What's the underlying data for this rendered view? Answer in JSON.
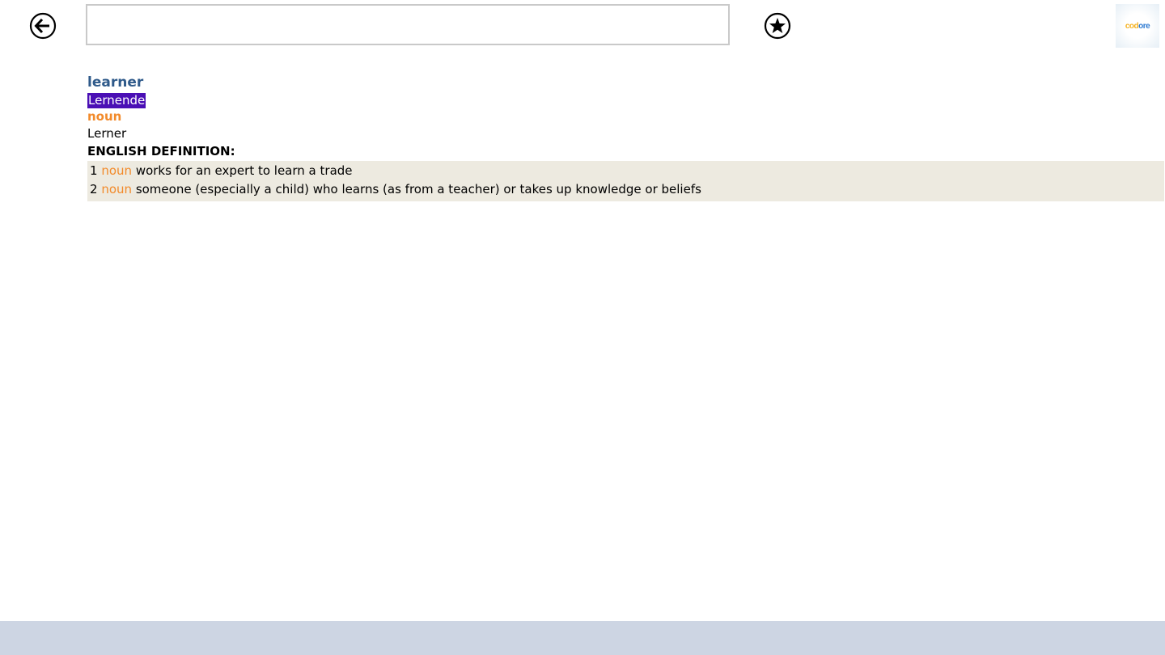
{
  "toolbar": {
    "back_icon": "arrow-left-circle-icon",
    "search": {
      "value": "",
      "placeholder": ""
    },
    "favorite_icon": "star-circle-icon",
    "logo": {
      "part1": "cod",
      "part2": "ore"
    }
  },
  "entry": {
    "headword": "learner",
    "translation_highlight": "Lernende",
    "part_of_speech": "noun",
    "translation_alt": "Lerner",
    "definition_heading": "ENGLISH DEFINITION:",
    "definitions": [
      {
        "num": "1",
        "pos": "noun",
        "text": "works for an expert to learn a trade"
      },
      {
        "num": "2",
        "pos": "noun",
        "text": "someone (especially a child) who learns (as from a teacher) or takes up knowledge or beliefs"
      }
    ]
  },
  "colors": {
    "headword": "#2f5a8a",
    "highlight_bg": "#4a0fb5",
    "pos": "#f28a2a",
    "definitions_bg": "#edeae0",
    "bottom_bar": "#cdd5e3"
  }
}
